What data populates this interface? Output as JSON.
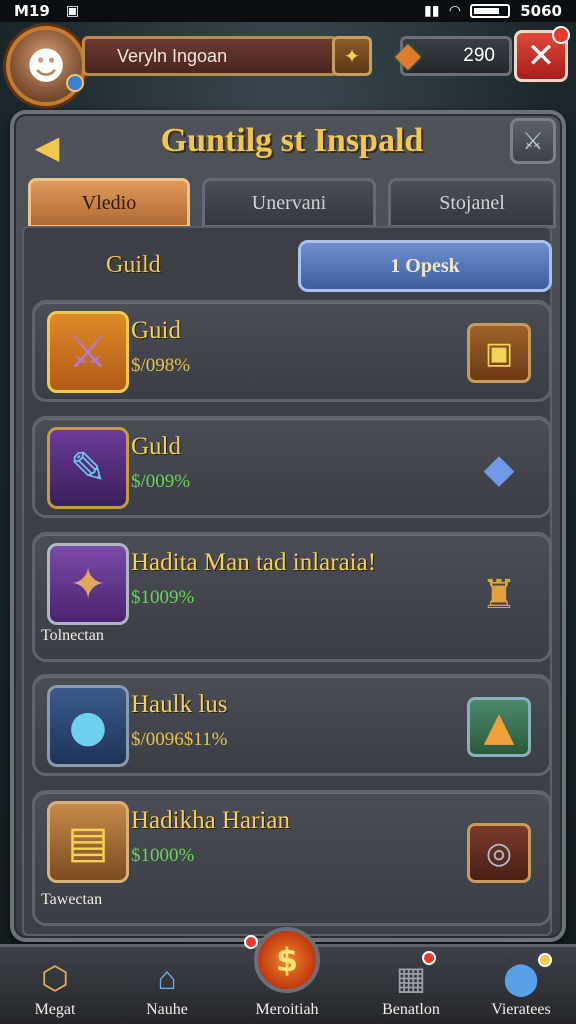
{
  "status_bar": {
    "time": "M19",
    "right_text": "5060"
  },
  "player": {
    "name": "Veryln Ingoan",
    "gems": "290"
  },
  "panel": {
    "title": "Guntilg st Inspald",
    "tabs": [
      {
        "label": "Vledio",
        "active": true
      },
      {
        "label": "Unervani",
        "active": false
      },
      {
        "label": "Stojanel",
        "active": false
      }
    ],
    "section_label": "Guild",
    "open_button": "1 Opesk"
  },
  "cards": [
    {
      "title": "Guid",
      "price": "$/098%",
      "price_color": "yellow",
      "caption": "",
      "thumb_icon": "sword-icon",
      "action_icon": "chest-icon"
    },
    {
      "title": "Guld",
      "price": "$/009%",
      "price_color": "green",
      "caption": "",
      "thumb_icon": "scroll-icon",
      "action_icon": "crystal-icon"
    },
    {
      "title": "Hadita Man tad inlaraia!",
      "price": "$1009%",
      "price_color": "green",
      "caption": "Tolnectan",
      "thumb_icon": "wand-icon",
      "action_icon": "horn-icon"
    },
    {
      "title": "Haulk lus",
      "price": "$/0096$11%",
      "price_color": "yellow",
      "caption": "",
      "thumb_icon": "orb-icon",
      "action_icon": "torch-icon"
    },
    {
      "title": "Hadikha Harian",
      "price": "$1000%",
      "price_color": "green",
      "caption": "Tawectan",
      "thumb_icon": "treasure-icon",
      "action_icon": "emblem-icon"
    }
  ],
  "bottom_nav": [
    {
      "label": "Megat",
      "icon": "shield-icon"
    },
    {
      "label": "Nauhe",
      "icon": "house-icon"
    },
    {
      "label": "Meroitiah",
      "icon": "coin-icon"
    },
    {
      "label": "Benatlon",
      "icon": "tower-icon"
    },
    {
      "label": "Vieratees",
      "icon": "potion-icon"
    }
  ],
  "colors": {
    "gold": "#f2c84c",
    "panel": "#4e5259",
    "accent_blue": "#3f5e9e",
    "close_red": "#c2281e"
  }
}
